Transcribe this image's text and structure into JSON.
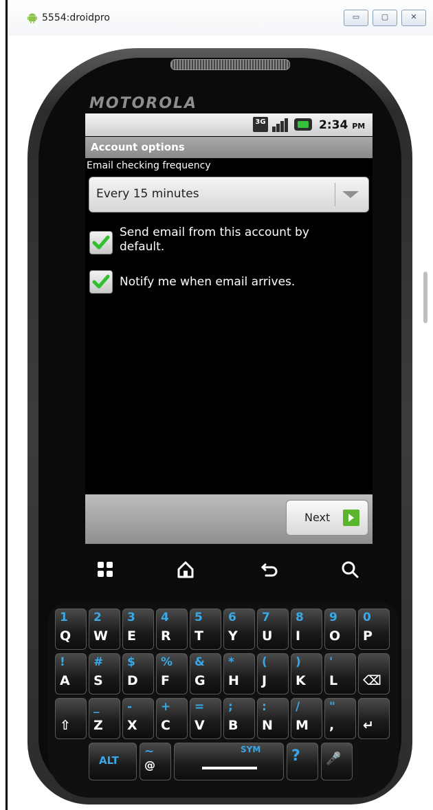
{
  "window": {
    "title": "5554:droidpro",
    "buttons": {
      "minimize": "▭",
      "maximize": "▢",
      "close": "✕"
    }
  },
  "phone": {
    "brand": "MOTOROLA"
  },
  "status_bar": {
    "network": "3G",
    "time": "2:34",
    "ampm": "PM",
    "icons": [
      "3g-icon",
      "signal-icon",
      "battery-icon"
    ]
  },
  "screen": {
    "title": "Account options",
    "frequency_label": "Email checking frequency",
    "frequency_value": "Every 15 minutes",
    "checkboxes": [
      {
        "label": "Send email from this account by default.",
        "checked": true
      },
      {
        "label": "Notify me when email arrives.",
        "checked": true
      }
    ],
    "next_label": "Next"
  },
  "soft_keys": [
    "menu-icon",
    "home-icon",
    "back-icon",
    "search-icon"
  ],
  "keyboard": {
    "row1": [
      {
        "alt": "1",
        "main": "Q"
      },
      {
        "alt": "2",
        "main": "W"
      },
      {
        "alt": "3",
        "main": "E"
      },
      {
        "alt": "4",
        "main": "R"
      },
      {
        "alt": "5",
        "main": "T"
      },
      {
        "alt": "6",
        "main": "Y"
      },
      {
        "alt": "7",
        "main": "U"
      },
      {
        "alt": "8",
        "main": "I"
      },
      {
        "alt": "9",
        "main": "O"
      },
      {
        "alt": "0",
        "main": "P"
      }
    ],
    "row2": [
      {
        "alt": "!",
        "main": "A"
      },
      {
        "alt": "#",
        "main": "S"
      },
      {
        "alt": "$",
        "main": "D"
      },
      {
        "alt": "%",
        "main": "F"
      },
      {
        "alt": "&",
        "main": "G"
      },
      {
        "alt": "*",
        "main": "H"
      },
      {
        "alt": "(",
        "main": "J"
      },
      {
        "alt": ")",
        "main": "K"
      },
      {
        "alt": "'",
        "main": "L"
      },
      {
        "alt": "",
        "main": "⌫"
      }
    ],
    "row3": [
      {
        "alt": "",
        "main": "⇧"
      },
      {
        "alt": "_",
        "main": "Z"
      },
      {
        "alt": "-",
        "main": "X"
      },
      {
        "alt": "+",
        "main": "C"
      },
      {
        "alt": "=",
        "main": "V"
      },
      {
        "alt": ";",
        "main": "B"
      },
      {
        "alt": ":",
        "main": "N"
      },
      {
        "alt": "/",
        "main": "M"
      },
      {
        "alt": "\"",
        "main": ","
      },
      {
        "alt": "",
        "main": "↵"
      }
    ],
    "row4": {
      "alt": "ALT",
      "at": "@",
      "at_alt": "~",
      "sym": "SYM",
      "question": "?",
      "mic": "🎤"
    }
  }
}
